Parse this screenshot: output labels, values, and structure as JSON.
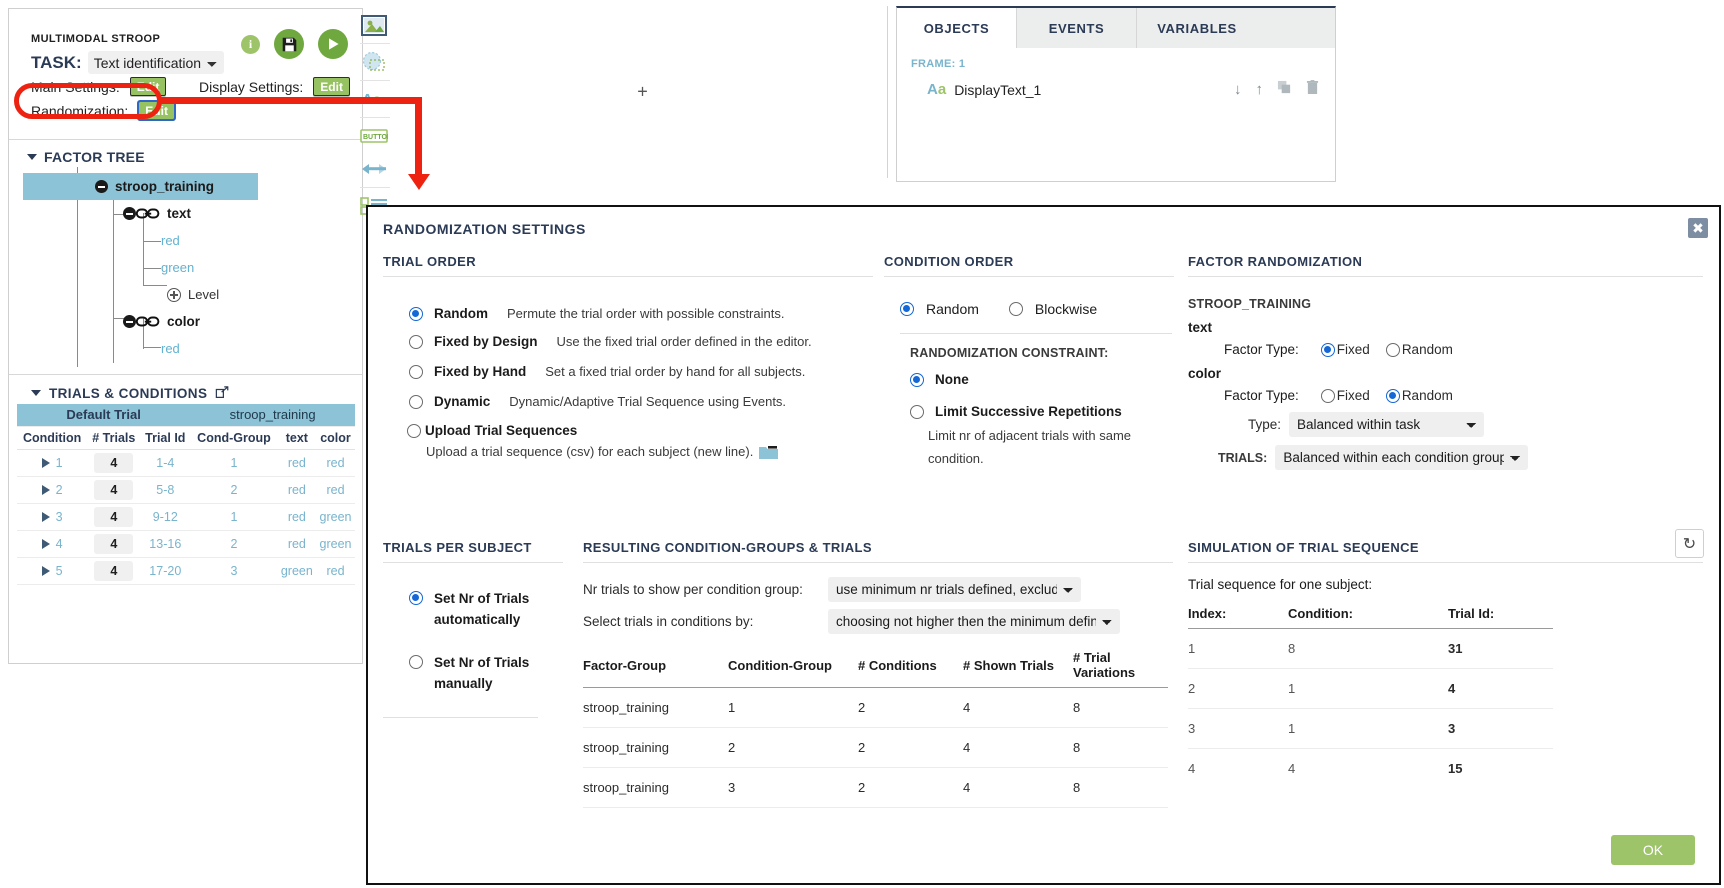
{
  "app": {
    "project_name": "MULTIMODAL STROOP",
    "task_label": "TASK:",
    "task_value": "Text identification",
    "main_settings_label": "Main Settings:",
    "display_settings_label": "Display Settings:",
    "randomization_label": "Randomization:",
    "edit_label": "Edit",
    "info_glyph": "i"
  },
  "factor_tree": {
    "title": "FACTOR TREE",
    "root": "stroop_training",
    "factors": [
      {
        "name": "text",
        "levels": [
          "red",
          "green"
        ],
        "add_level_label": "Level"
      },
      {
        "name": "color",
        "levels": [
          "red"
        ]
      }
    ]
  },
  "trials_conditions": {
    "title": "TRIALS & CONDITIONS",
    "band_left": "Default Trial",
    "band_right": "stroop_training",
    "columns": [
      "Condition",
      "# Trials",
      "Trial Id",
      "Cond-Group",
      "text",
      "color"
    ],
    "rows": [
      {
        "condition": "1",
        "trials": "4",
        "trial_id": "1-4",
        "cond_group": "1",
        "text": "red",
        "color": "red"
      },
      {
        "condition": "2",
        "trials": "4",
        "trial_id": "5-8",
        "cond_group": "2",
        "text": "red",
        "color": "red"
      },
      {
        "condition": "3",
        "trials": "4",
        "trial_id": "9-12",
        "cond_group": "1",
        "text": "red",
        "color": "green"
      },
      {
        "condition": "4",
        "trials": "4",
        "trial_id": "13-16",
        "cond_group": "2",
        "text": "red",
        "color": "green"
      },
      {
        "condition": "5",
        "trials": "4",
        "trial_id": "17-20",
        "cond_group": "3",
        "text": "green",
        "color": "red"
      }
    ]
  },
  "canvas": {
    "plus": "+"
  },
  "toolbar": {
    "items": [
      "image-icon",
      "shape-icon",
      "text-icon",
      "button-icon",
      "list-icon"
    ]
  },
  "objects_panel": {
    "tabs": [
      {
        "label": "OBJECTS",
        "active": true
      },
      {
        "label": "EVENTS",
        "active": false
      },
      {
        "label": "VARIABLES",
        "active": false
      }
    ],
    "frame_label": "FRAME: 1",
    "object_name": "DisplayText_1",
    "object_icon": "Aa"
  },
  "modal": {
    "title": "RANDOMIZATION SETTINGS",
    "close_glyph": "✖",
    "ok_label": "OK",
    "refresh_glyph": "↻",
    "trial_order": {
      "title": "TRIAL ORDER",
      "options": [
        {
          "name": "Random",
          "desc": "Permute the trial order with possible constraints.",
          "selected": true
        },
        {
          "name": "Fixed by Design",
          "desc": "Use the fixed trial order defined in the editor.",
          "selected": false
        },
        {
          "name": "Fixed by Hand",
          "desc": "Set a fixed trial order by hand for all subjects.",
          "selected": false
        },
        {
          "name": "Dynamic",
          "desc": "Dynamic/Adaptive Trial Sequence using Events.",
          "selected": false
        },
        {
          "name": "Upload Trial Sequences",
          "desc": "",
          "selected": false
        }
      ],
      "upload_hint": "Upload a trial sequence (csv) for each subject (new line)."
    },
    "trials_per_subject": {
      "title": "TRIALS PER SUBJECT",
      "options": [
        {
          "name": "Set Nr of Trials automatically",
          "selected": true
        },
        {
          "name": "Set Nr of Trials manually",
          "selected": false
        }
      ]
    },
    "condition_order": {
      "title": "CONDITION ORDER",
      "modes": [
        {
          "name": "Random",
          "selected": true
        },
        {
          "name": "Blockwise",
          "selected": false
        }
      ],
      "constraint_title": "RANDOMIZATION CONSTRAINT:",
      "constraints": [
        {
          "name": "None",
          "desc": "",
          "selected": true
        },
        {
          "name": "Limit Successive Repetitions",
          "desc": "Limit nr of adjacent trials with same condition.",
          "selected": false
        }
      ]
    },
    "factor_randomization": {
      "title": "FACTOR RANDOMIZATION",
      "group_name": "STROOP_TRAINING",
      "factor_type_label": "Factor Type:",
      "fixed_label": "Fixed",
      "random_label": "Random",
      "factors": [
        {
          "name": "text",
          "type": "Fixed"
        },
        {
          "name": "color",
          "type": "Random"
        }
      ],
      "type_label": "Type:",
      "type_value": "Balanced within task",
      "trials_label": "TRIALS:",
      "trials_value": "Balanced within each condition group"
    },
    "resulting": {
      "title": "RESULTING CONDITION-GROUPS & TRIALS",
      "nr_trials_label": "Nr trials to show per condition group:",
      "nr_trials_value": "use minimum nr trials defined, exclude zero",
      "select_trials_label": "Select trials in conditions by:",
      "select_trials_value": "choosing not higher then the minimum defined",
      "columns": [
        "Factor-Group",
        "Condition-Group",
        "# Conditions",
        "# Shown Trials",
        "# Trial Variations"
      ],
      "rows": [
        {
          "factor_group": "stroop_training",
          "condition_group": "1",
          "conditions": "2",
          "shown_trials": "4",
          "trial_variations": "8"
        },
        {
          "factor_group": "stroop_training",
          "condition_group": "2",
          "conditions": "2",
          "shown_trials": "4",
          "trial_variations": "8"
        },
        {
          "factor_group": "stroop_training",
          "condition_group": "3",
          "conditions": "2",
          "shown_trials": "4",
          "trial_variations": "8"
        }
      ]
    },
    "simulation": {
      "title": "SIMULATION OF TRIAL SEQUENCE",
      "subtitle": "Trial sequence for one subject:",
      "columns": [
        "Index:",
        "Condition:",
        "Trial Id:"
      ],
      "rows": [
        {
          "index": "1",
          "condition": "8",
          "trial_id": "31"
        },
        {
          "index": "2",
          "condition": "1",
          "trial_id": "4"
        },
        {
          "index": "3",
          "condition": "1",
          "trial_id": "3"
        },
        {
          "index": "4",
          "condition": "4",
          "trial_id": "15"
        }
      ]
    }
  },
  "colors": {
    "accent_green": "#9ec46a",
    "accent_blue": "#2b3a55",
    "band_blue": "#8dc3d6",
    "link_blue": "#79b4cd",
    "radio_blue": "#1367d6",
    "annotation_red": "#ee2211"
  }
}
